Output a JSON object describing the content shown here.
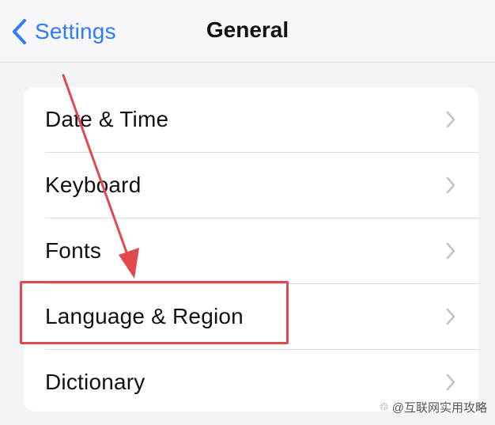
{
  "navbar": {
    "back_label": "Settings",
    "title": "General"
  },
  "rows": [
    {
      "label": "Date & Time"
    },
    {
      "label": "Keyboard"
    },
    {
      "label": "Fonts"
    },
    {
      "label": "Language & Region"
    },
    {
      "label": "Dictionary"
    }
  ],
  "annotation": {
    "highlighted_row": "Language & Region",
    "color": "#e04a4f"
  },
  "watermark": {
    "text": "@互联网实用攻略"
  },
  "colors": {
    "accent": "#2f7cf6",
    "background": "#f2f2f7",
    "card": "#ffffff",
    "chevron": "#c4c4c8"
  },
  "icons": {
    "back": "chevron-left-icon",
    "row_disclosure": "chevron-right-icon"
  }
}
